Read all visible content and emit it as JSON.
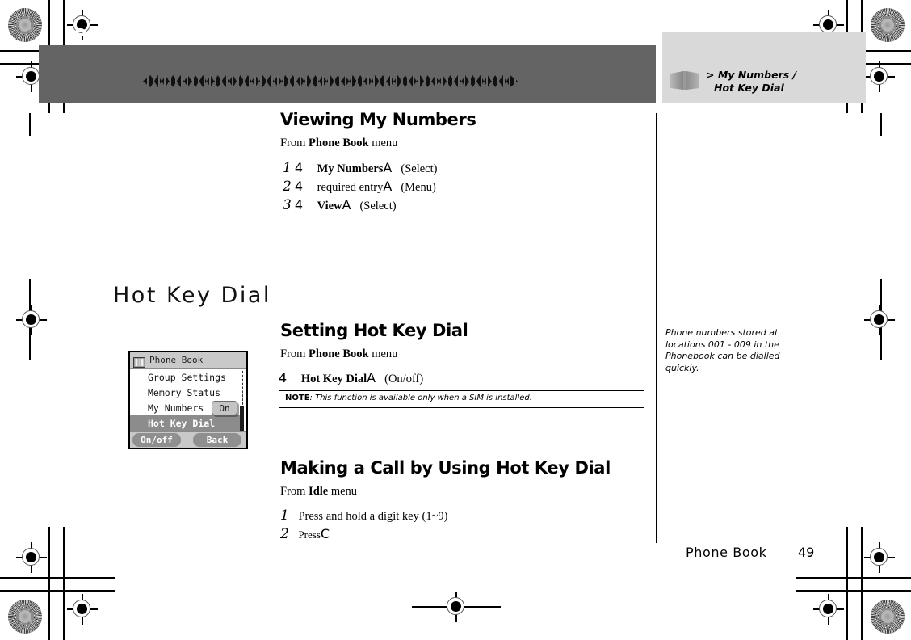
{
  "header": {
    "title": "Phone Book",
    "tab_icon": "open-book-icon",
    "tab_line1": "> My Numbers /",
    "tab_line2": "Hot Key Dial"
  },
  "sections": {
    "viewing": {
      "heading": "Viewing My Numbers",
      "from_prefix": "From ",
      "from_bold": "Phone Book",
      "from_suffix": " menu",
      "steps": [
        {
          "num": "1",
          "arrow": "4",
          "target": "My Numbers",
          "target_bold": true,
          "key": "A",
          "action": "(Select)"
        },
        {
          "num": "2",
          "arrow": "4",
          "target": "required entry",
          "target_bold": false,
          "key": "A",
          "action": "(Menu)"
        },
        {
          "num": "3",
          "arrow": "4",
          "target": "View",
          "target_bold": true,
          "key": "A",
          "action": "(Select)"
        }
      ]
    },
    "hotkey_title": "Hot Key Dial",
    "setting": {
      "heading": "Setting Hot Key Dial",
      "from_prefix": "From ",
      "from_bold": "Phone Book",
      "from_suffix": " menu",
      "step": {
        "arrow": "4",
        "target": "Hot Key Dial",
        "key": "A",
        "action": "(On/off)"
      },
      "note_label": "NOTE",
      "note_text": ": This function is available only when a SIM is installed."
    },
    "making_call": {
      "heading": "Making a Call by Using Hot Key Dial",
      "from_prefix": "From ",
      "from_bold": "Idle",
      "from_suffix": " menu",
      "steps": [
        {
          "num": "1",
          "text": "Press and hold a digit key (1~9)",
          "key": ""
        },
        {
          "num": "2",
          "text": "Press",
          "key": "C"
        }
      ]
    }
  },
  "margin_note": "Phone numbers stored at locations 001 - 009 in the Phonebook can be dialled quickly.",
  "phone_mock": {
    "title_icon": "book-icon",
    "title": "Phone Book",
    "items": [
      "Group Settings",
      "Memory Status",
      "My Numbers"
    ],
    "selected_item": "Hot Key Dial",
    "tooltip": "On",
    "softkey_left": "On/off",
    "softkey_right": "Back"
  },
  "footer": {
    "label": "Phone Book",
    "page": "49"
  },
  "colors": {
    "header_bar": "#646464",
    "header_tab": "#d9d9d9",
    "highlight": "#8c8c8c"
  }
}
